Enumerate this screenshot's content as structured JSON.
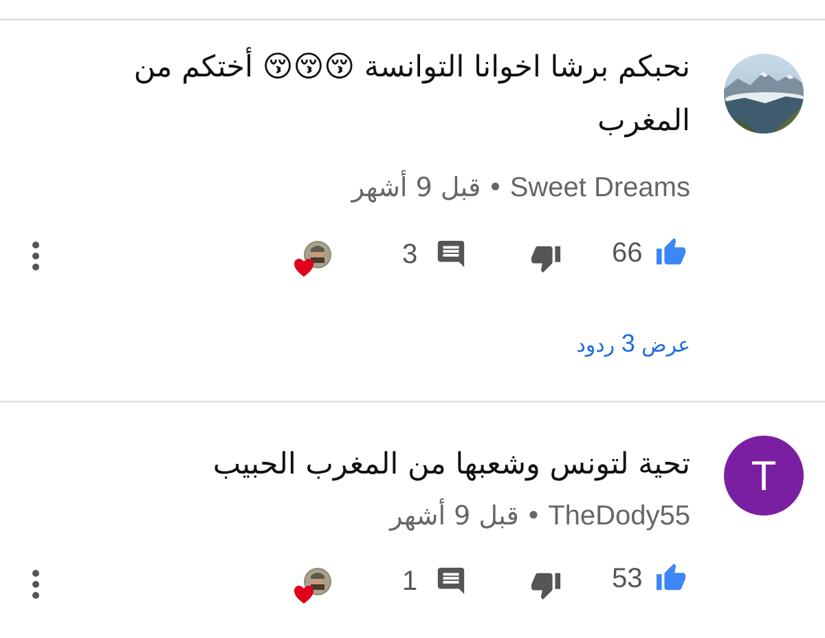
{
  "comments": [
    {
      "author": "Sweet Dreams",
      "time": "قبل 9 أشهر",
      "text": "نحبكم برشا اخوانا التوانسة 😚😚😚 أختكم من المغرب",
      "likes": "66",
      "replies_count": "3",
      "view_replies": {
        "prefix": "عرض",
        "count": "3",
        "suffix": "ردود"
      },
      "avatar_type": "landscape-photo"
    },
    {
      "author": "TheDody55",
      "time": "قبل 9 أشهر",
      "text": "تحية لتونس وشعبها من المغرب الحبيب",
      "likes": "53",
      "replies_count": "1",
      "avatar_letter": "T",
      "avatar_color": "#7b1fa2"
    }
  ],
  "separator": "•",
  "colors": {
    "like_blue": "#3d86f5",
    "link_blue": "#1e6be0",
    "icon_gray": "#555555",
    "heart_red": "#e0001b"
  },
  "icons": [
    "thumbs-up-icon",
    "thumbs-down-icon",
    "comment-icon",
    "more-vert-icon",
    "creator-heart-icon"
  ]
}
